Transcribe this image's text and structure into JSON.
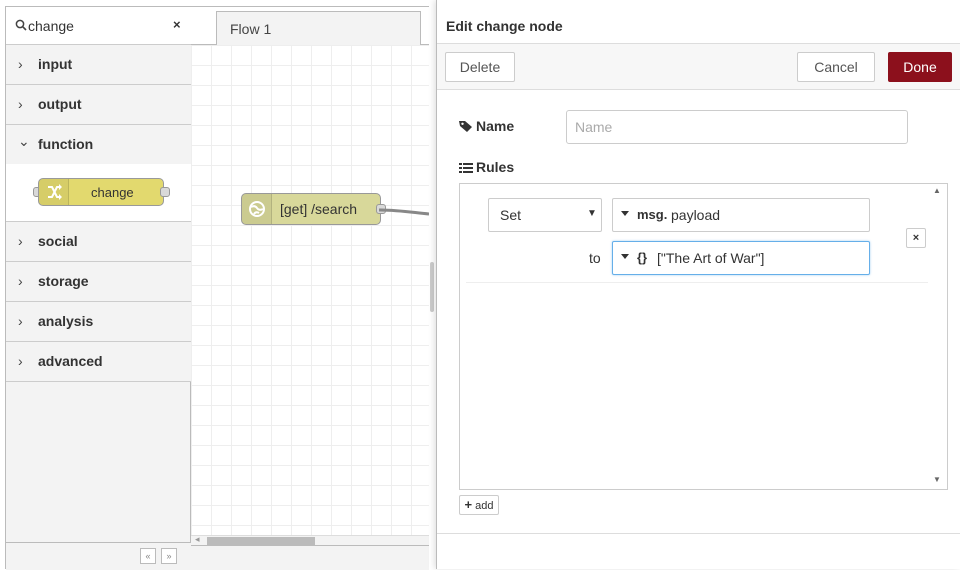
{
  "palette": {
    "search_value": "change",
    "clear_icon": "×",
    "categories": [
      {
        "label": "input",
        "chevron": "›"
      },
      {
        "label": "output",
        "chevron": "›"
      },
      {
        "label": "function",
        "chevron": "⌄"
      },
      {
        "label": "social",
        "chevron": "›"
      },
      {
        "label": "storage",
        "chevron": "›"
      },
      {
        "label": "analysis",
        "chevron": "›"
      },
      {
        "label": "advanced",
        "chevron": "›"
      }
    ],
    "change_node_label": "change",
    "change_node_color": "#e2d96e",
    "footer_up": "«",
    "footer_down": "»"
  },
  "workspace": {
    "tab_label": "Flow 1",
    "node_label": "[get] /search",
    "node_color": "#d8d89a"
  },
  "tray": {
    "title": "Edit change node",
    "delete_label": "Delete",
    "cancel_label": "Cancel",
    "done_label": "Done",
    "done_color": "#8c101c",
    "name_label": "Name",
    "name_placeholder": "Name",
    "rules_label": "Rules",
    "rule": {
      "action": "Set",
      "action_arrow": "▼",
      "target_type": "msg.",
      "target_value": "payload",
      "to_label": "to",
      "value_type": "{}",
      "value": "[\"The Art of War\"]",
      "remove": "×"
    },
    "add_label": "add",
    "add_icon": "+"
  }
}
